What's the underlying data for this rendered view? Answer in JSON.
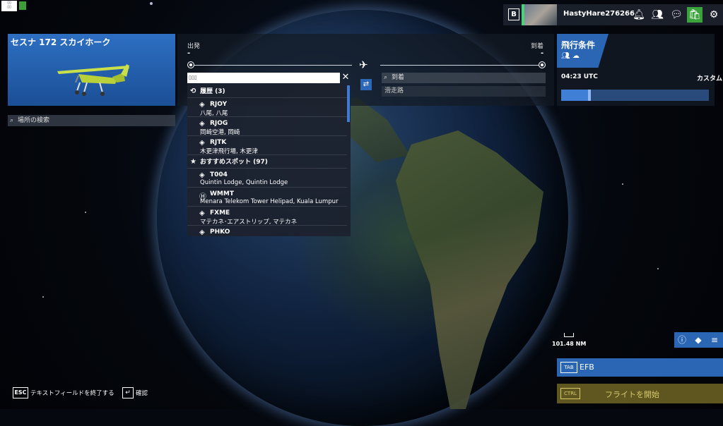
{
  "topbar": {
    "key_b": "B",
    "username": "HastyHare276266",
    "icons": [
      "bell-icon",
      "friends-icon",
      "chat-icon",
      "shop-icon",
      "gear-icon"
    ]
  },
  "aircraft": {
    "name": "セスナ 172 スカイホーク"
  },
  "location_search": {
    "placeholder": "場所の検索"
  },
  "route": {
    "departure_label": "出発",
    "arrival_label": "到着",
    "departure_value": "-",
    "arrival_value": "-",
    "departure_input_value": "▯▯▯",
    "arrival_input_placeholder": "到着",
    "runway_label": "滑走路"
  },
  "dropdown": {
    "history_header": "履歴 (3)",
    "history": [
      {
        "code": "RJOY",
        "name": "八尾, 八尾"
      },
      {
        "code": "RJOG",
        "name": "岡崎空港, 岡崎"
      },
      {
        "code": "RJTK",
        "name": "木更津飛行場, 木更津"
      }
    ],
    "featured_header": "おすすめスポット (97)",
    "featured": [
      {
        "code": "T004",
        "name": "Quintin Lodge, Quintin Lodge"
      },
      {
        "code": "WMMT",
        "name": "Menara Telekom Tower Helipad, Kuala Lumpur"
      },
      {
        "code": "FXME",
        "name": "マテカネ･エアストリップ, マテカネ"
      },
      {
        "code": "PHKO",
        "name": ""
      }
    ]
  },
  "conditions": {
    "title": "飛行条件",
    "time": "04:23 UTC",
    "mode": "カスタム",
    "time_progress": 0.2
  },
  "map": {
    "scale": "101.48 NM"
  },
  "efb": {
    "key": "TAB",
    "label": "EFB"
  },
  "start_flight": {
    "key": "CTRL",
    "label": "フライトを開始"
  },
  "footer": {
    "esc_key": "ESC",
    "esc_label": "テキストフィールドを終了する",
    "enter_label": "確認"
  }
}
